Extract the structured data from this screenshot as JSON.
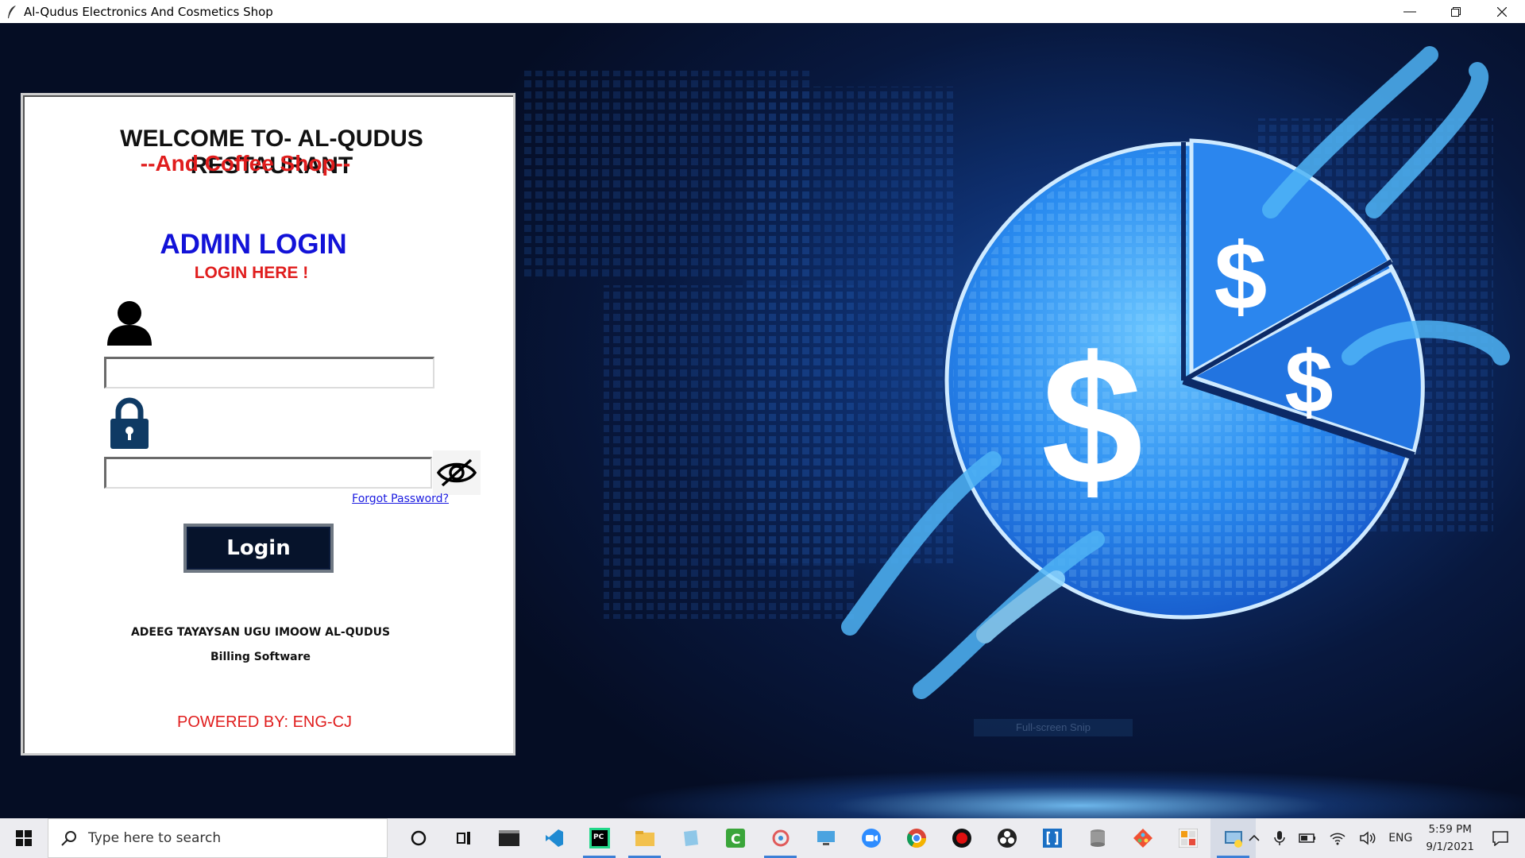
{
  "window": {
    "title": "Al-Qudus Electronics And Cosmetics Shop",
    "controls": [
      "minimize",
      "restore",
      "close"
    ]
  },
  "login_panel": {
    "welcome": "WELCOME TO- AL-QUDUS RESTAURANT",
    "subtitle": "--And Coffee Shop--",
    "heading": "ADMIN LOGIN",
    "subheading": "LOGIN HERE !",
    "username_value": "",
    "password_value": "",
    "forgot_link": "Forgot Password?",
    "login_button": "Login",
    "footer_line1": "ADEEG TAYAYSAN UGU IMOOW AL-QUDUS",
    "footer_line2": "Billing Software",
    "powered_by": "POWERED BY: ENG-CJ",
    "icons": [
      "user-icon",
      "lock-icon",
      "eye-slash-icon"
    ],
    "colors": {
      "accent_red": "#e01d1d",
      "heading_blue": "#1212d8",
      "button_bg": "#06132b"
    }
  },
  "background": {
    "snip_hint": "Full-screen Snip",
    "art": "blue pie chart with dollar signs and chain links"
  },
  "taskbar": {
    "search_placeholder": "Type here to search",
    "apps": [
      "cortana-icon",
      "task-view-icon",
      "terminal-icon",
      "vscode-icon",
      "pycharm-icon",
      "file-explorer-icon",
      "notepad-icon",
      "camtasia-icon",
      "paint-icon",
      "remote-desktop-icon",
      "zoom-icon",
      "chrome-icon",
      "record-icon",
      "obs-icon",
      "brackets-icon",
      "database-icon",
      "git-icon",
      "calculator-icon",
      "python-app-icon"
    ],
    "tray": {
      "language": "ENG",
      "time": "5:59 PM",
      "date": "9/1/2021"
    }
  }
}
